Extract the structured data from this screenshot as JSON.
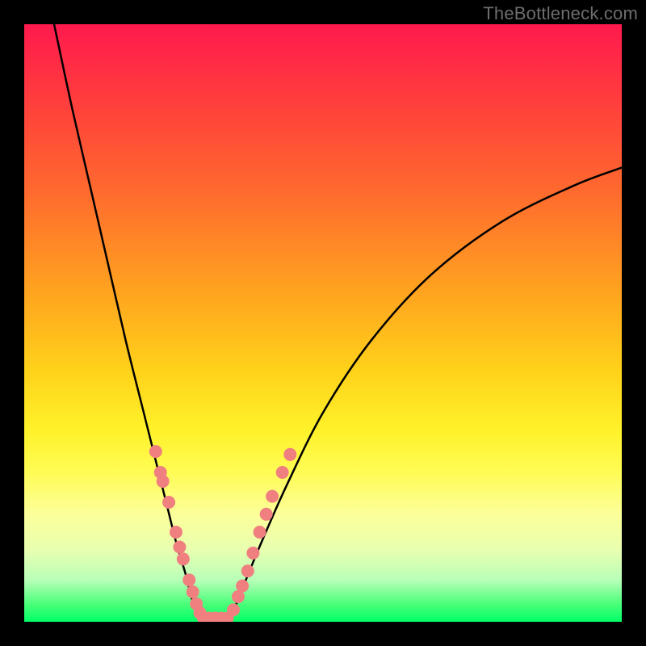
{
  "watermark": {
    "text": "TheBottleneck.com"
  },
  "chart_data": {
    "type": "line",
    "title": "",
    "xlabel": "",
    "ylabel": "",
    "xlim": [
      0,
      100
    ],
    "ylim": [
      0,
      100
    ],
    "series": [
      {
        "name": "bottleneck-curve-left",
        "x": [
          5,
          8,
          11,
          14,
          17,
          20,
          22,
          24,
          25.5,
          27,
          28,
          29,
          30
        ],
        "y": [
          100,
          86,
          73,
          60,
          47,
          35,
          27,
          19,
          13,
          8,
          4,
          1.5,
          0
        ]
      },
      {
        "name": "bottleneck-curve-right",
        "x": [
          34,
          35.5,
          37.5,
          40,
          44,
          50,
          58,
          68,
          80,
          92,
          100
        ],
        "y": [
          0,
          3,
          8,
          14,
          23,
          35,
          47,
          58,
          67,
          73,
          76
        ]
      }
    ],
    "markers": [
      {
        "name": "marker-cluster-left",
        "color": "#f08080",
        "points": [
          {
            "x": 22.0,
            "y": 28.5
          },
          {
            "x": 22.8,
            "y": 25.0
          },
          {
            "x": 23.2,
            "y": 23.5
          },
          {
            "x": 24.2,
            "y": 20.0
          },
          {
            "x": 25.4,
            "y": 15.0
          },
          {
            "x": 26.0,
            "y": 12.5
          },
          {
            "x": 26.6,
            "y": 10.5
          },
          {
            "x": 27.6,
            "y": 7.0
          },
          {
            "x": 28.2,
            "y": 5.0
          },
          {
            "x": 28.8,
            "y": 3.0
          },
          {
            "x": 29.4,
            "y": 1.5
          }
        ]
      },
      {
        "name": "marker-cluster-bottom",
        "color": "#f08080",
        "points": [
          {
            "x": 30.0,
            "y": 0.6
          },
          {
            "x": 31.0,
            "y": 0.6
          },
          {
            "x": 32.0,
            "y": 0.6
          },
          {
            "x": 33.0,
            "y": 0.6
          },
          {
            "x": 34.0,
            "y": 0.6
          }
        ]
      },
      {
        "name": "marker-cluster-right",
        "color": "#f08080",
        "points": [
          {
            "x": 35.0,
            "y": 2.0
          },
          {
            "x": 35.8,
            "y": 4.2
          },
          {
            "x": 36.5,
            "y": 6.0
          },
          {
            "x": 37.4,
            "y": 8.5
          },
          {
            "x": 38.3,
            "y": 11.5
          },
          {
            "x": 39.4,
            "y": 15.0
          },
          {
            "x": 40.5,
            "y": 18.0
          },
          {
            "x": 41.5,
            "y": 21.0
          },
          {
            "x": 43.2,
            "y": 25.0
          },
          {
            "x": 44.5,
            "y": 28.0
          }
        ]
      }
    ],
    "gradient_stops": [
      {
        "pos": 0,
        "color": "#ff1a4d"
      },
      {
        "pos": 12,
        "color": "#ff3b3e"
      },
      {
        "pos": 28,
        "color": "#ff6a2e"
      },
      {
        "pos": 45,
        "color": "#ffa41f"
      },
      {
        "pos": 58,
        "color": "#ffd21a"
      },
      {
        "pos": 68,
        "color": "#fff22a"
      },
      {
        "pos": 75,
        "color": "#fffc55"
      },
      {
        "pos": 82,
        "color": "#fcff9a"
      },
      {
        "pos": 88,
        "color": "#e8ffb0"
      },
      {
        "pos": 93,
        "color": "#b8ffb8"
      },
      {
        "pos": 97,
        "color": "#4bff7a"
      },
      {
        "pos": 100,
        "color": "#00ff66"
      }
    ]
  }
}
